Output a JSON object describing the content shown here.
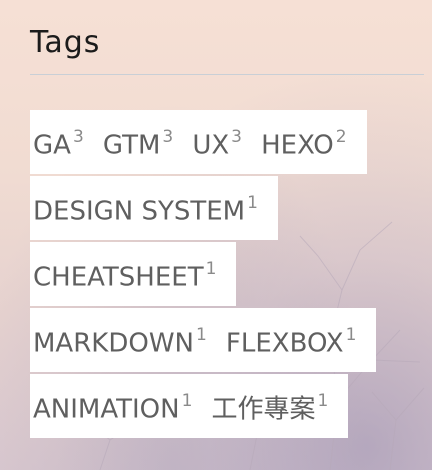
{
  "widget": {
    "title": "Tags"
  },
  "tags": [
    [
      {
        "name": "GA",
        "count": "3"
      },
      {
        "name": "GTM",
        "count": "3"
      },
      {
        "name": "UX",
        "count": "3"
      },
      {
        "name": "HEXO",
        "count": "2"
      }
    ],
    [
      {
        "name": "DESIGN SYSTEM",
        "count": "1"
      }
    ],
    [
      {
        "name": "CHEATSHEET",
        "count": "1"
      }
    ],
    [
      {
        "name": "MARKDOWN",
        "count": "1"
      },
      {
        "name": "FLEXBOX",
        "count": "1"
      }
    ],
    [
      {
        "name": "ANIMATION",
        "count": "1"
      },
      {
        "name": "工作專案",
        "count": "1"
      }
    ]
  ]
}
